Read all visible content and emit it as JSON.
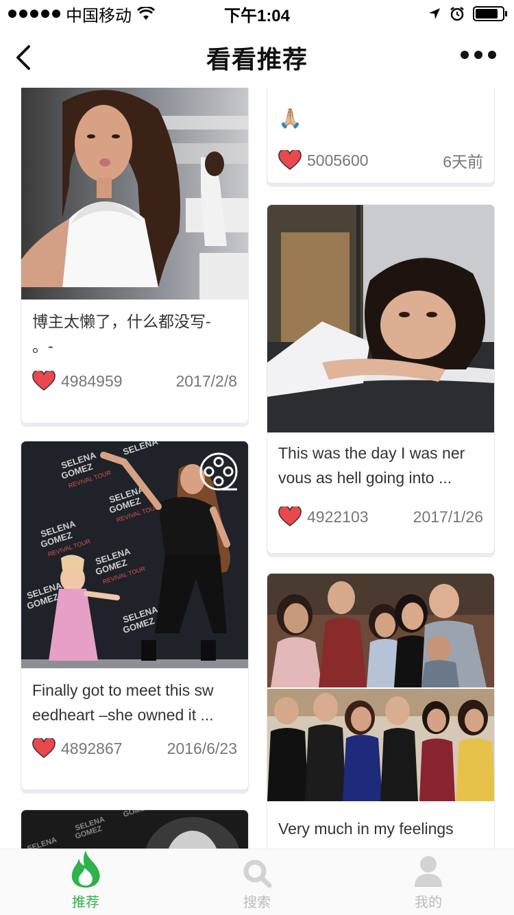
{
  "status_bar": {
    "carrier": "中国移动",
    "time": "下午1:04"
  },
  "nav": {
    "title": "看看推荐"
  },
  "cards": [
    {
      "caption": "🙏🏼",
      "likes": "5005600",
      "date": "6天前"
    },
    {
      "caption": "博主太懒了，什么都没写-\n。-",
      "likes": "4984959",
      "date": "2017/2/8"
    },
    {
      "caption": "This was the day I was ner\nvous as hell going into ...",
      "likes": "4922103",
      "date": "2017/1/26"
    },
    {
      "caption": "Finally got to meet this sw\needheart –she owned it ...",
      "likes": "4892867",
      "date": "2016/6/23"
    },
    {
      "caption": "Very much in my feelings",
      "likes": "",
      "date": ""
    }
  ],
  "backdrop_text": "SELENA GOMEZ REVIVAL TOUR",
  "tabs": [
    {
      "label": "推荐",
      "icon": "flame-icon",
      "active": true
    },
    {
      "label": "搜索",
      "icon": "search-icon",
      "active": false
    },
    {
      "label": "我的",
      "icon": "person-icon",
      "active": false
    }
  ],
  "colors": {
    "accent": "#2db34a",
    "heart": "#e8484e"
  }
}
